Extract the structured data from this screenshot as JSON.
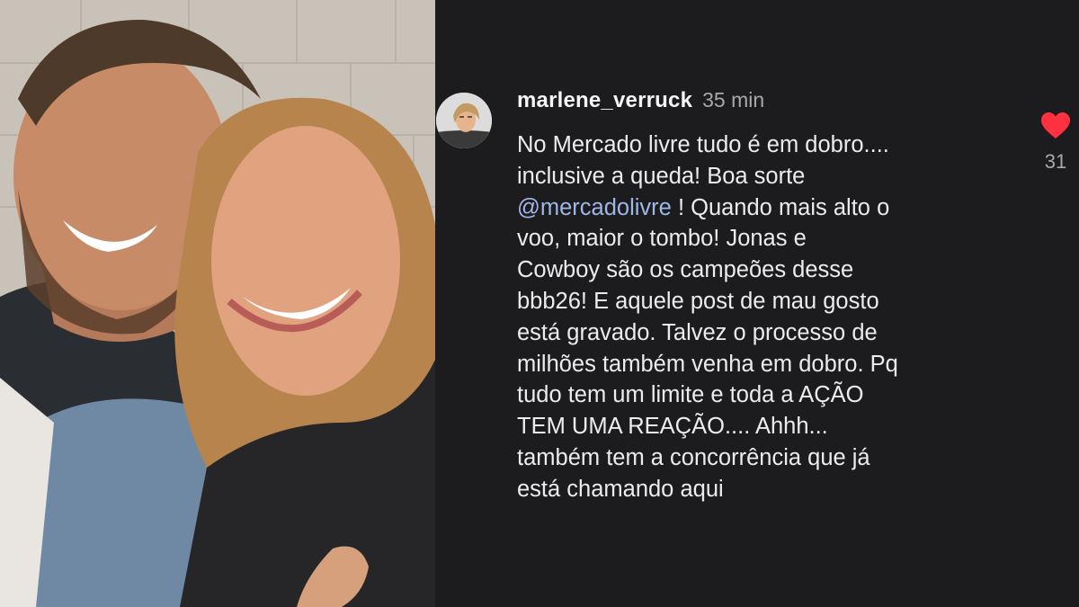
{
  "photo": {
    "alt_name": "selfie-photo"
  },
  "comment": {
    "username": "marlene_verruck",
    "time": "35 min",
    "text_before": "No Mercado livre tudo é em dobro....\ninclusive a queda!  Boa sorte\n",
    "mention": "@mercadolivre",
    "text_after": " ! Quando mais alto o\nvoo, maior o tombo!  Jonas e\nCowboy são os campeões  desse\nbbb26!  E aquele post de mau gosto\nestá  gravado.  Talvez o processo de\nmilhões também venha em dobro. Pq\ntudo tem um limite e toda a AÇÃO\nTEM UMA REAÇÃO.... Ahhh...\ntambém tem a concorrência  que já\nestá chamando aqui",
    "likes": "31"
  },
  "colors": {
    "background": "#1c1c1f",
    "mention": "#9fb6e6",
    "heart": "#ff3040",
    "muted": "#a8a8ad"
  },
  "icons": {
    "mention_icon": "threads-at-icon",
    "like_icon": "heart-icon"
  }
}
